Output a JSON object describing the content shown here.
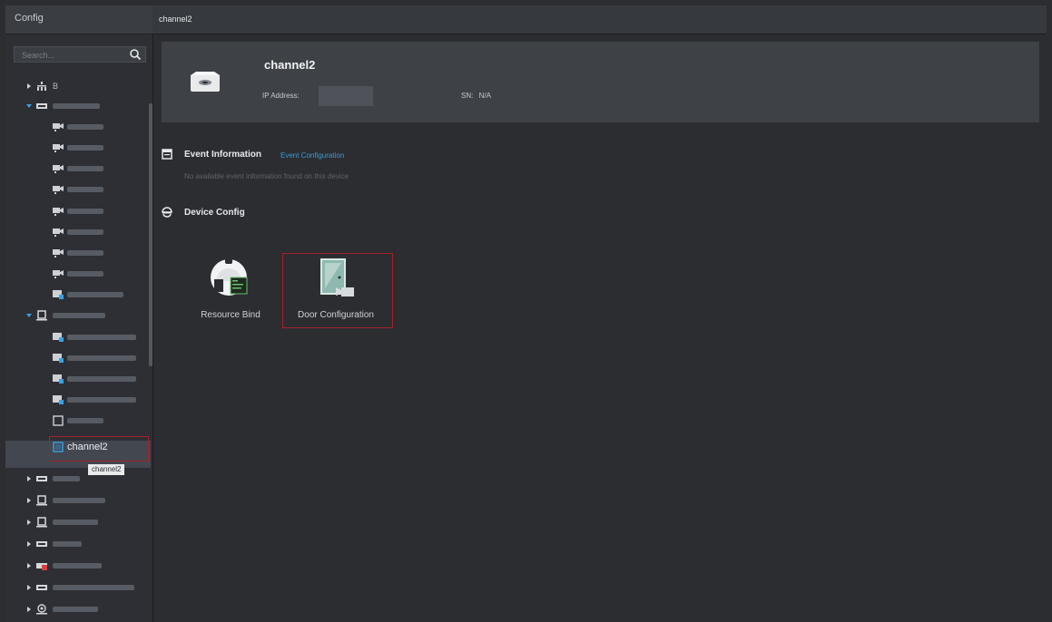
{
  "sidebar": {
    "title": "Config",
    "search_placeholder": "Search...",
    "tree_root_label": "B",
    "selected_label": "channel2",
    "tooltip_text": "channel2"
  },
  "topbar": {
    "title": "channel2"
  },
  "device": {
    "name": "channel2",
    "ip_label": "IP Address:",
    "sn_label": "SN:",
    "sn_value": "N/A"
  },
  "event_section": {
    "title": "Event Information",
    "link_label": "Event Configuration",
    "empty_message": "No available event information found on this device"
  },
  "device_config_section": {
    "title": "Device Config",
    "tiles": [
      {
        "label": "Resource Bind"
      },
      {
        "label": "Door Configuration"
      }
    ]
  },
  "colors": {
    "background": "#2b2d31",
    "accent_link": "#3a9bd9",
    "highlight_border": "#a3232b"
  }
}
